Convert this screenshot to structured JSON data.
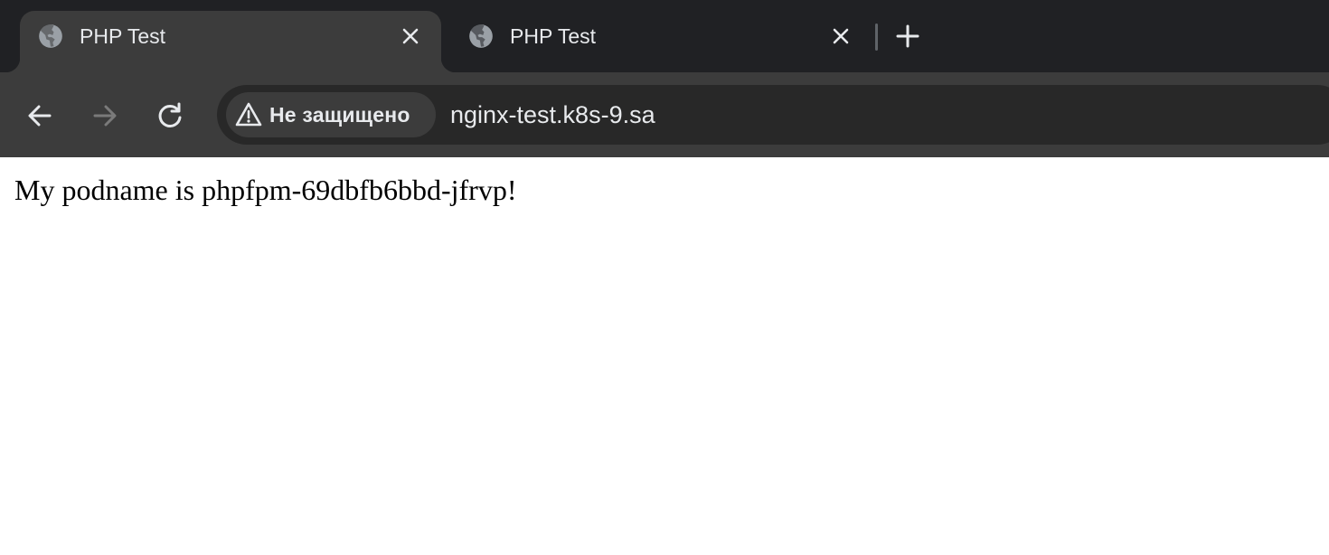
{
  "browser": {
    "tabs": [
      {
        "title": "PHP Test",
        "active": true,
        "favicon": "globe-icon"
      },
      {
        "title": "PHP Test",
        "active": false,
        "favicon": "globe-icon"
      }
    ],
    "new_tab_icon": "plus-icon",
    "toolbar": {
      "back_icon": "arrow-left-icon",
      "forward_icon": "arrow-right-icon",
      "reload_icon": "reload-icon",
      "security_label": "Не защищено",
      "security_icon": "warning-triangle-icon",
      "url": "nginx-test.k8s-9.sa"
    },
    "colors": {
      "tabstrip": "#202124",
      "toolbar": "#3c3c3c",
      "omnibox": "#282828",
      "text_light": "#e8eaed",
      "icon_disabled": "#7a7a7a"
    }
  },
  "page": {
    "body_text": "My podname is phpfpm-69dbfb6bbd-jfrvp!"
  }
}
